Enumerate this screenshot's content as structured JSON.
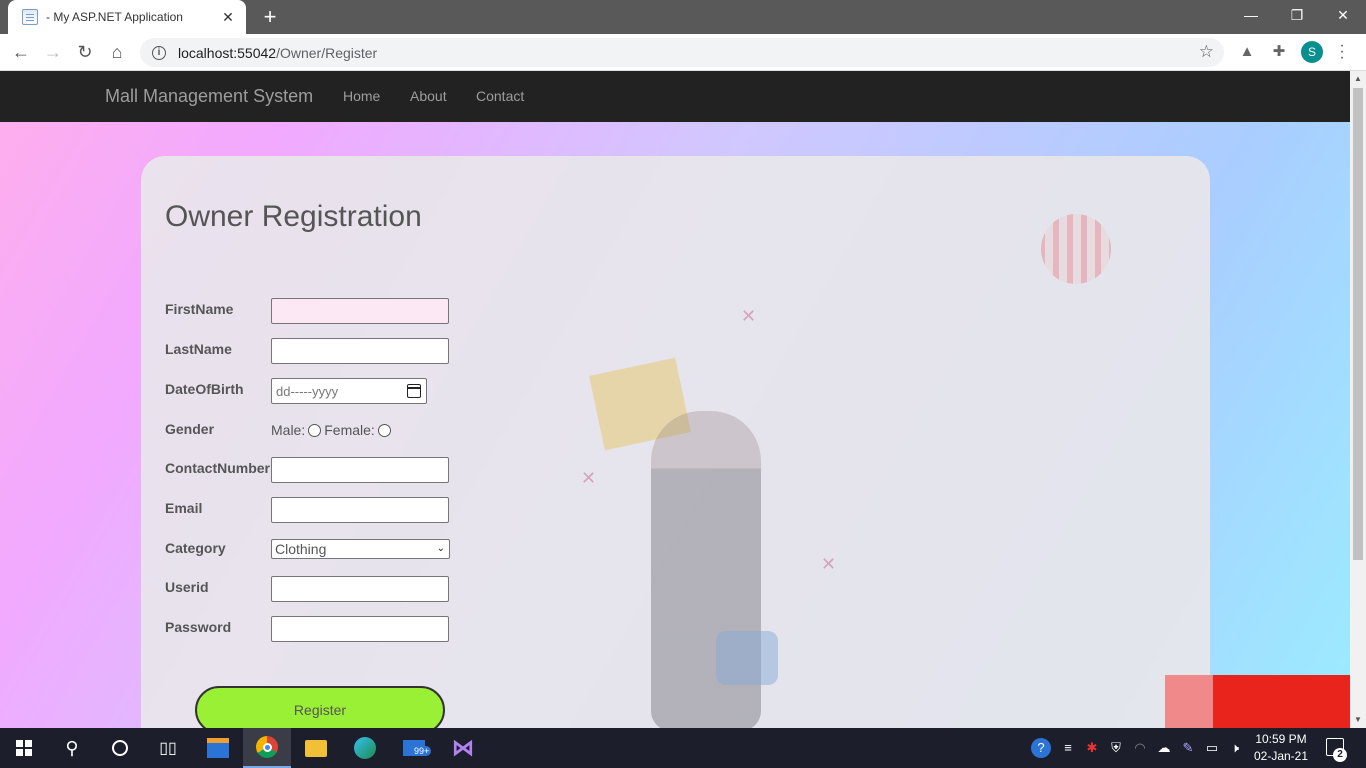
{
  "browser": {
    "tab_title": "- My ASP.NET Application",
    "url_host": "localhost:55042",
    "url_path": "/Owner/Register",
    "profile_initial": "S"
  },
  "site": {
    "brand": "Mall Management System",
    "nav": [
      "Home",
      "About",
      "Contact"
    ]
  },
  "form": {
    "title": "Owner Registration",
    "labels": {
      "first_name": "FirstName",
      "last_name": "LastName",
      "dob": "DateOfBirth",
      "gender": "Gender",
      "contact": "ContactNumber",
      "email": "Email",
      "category": "Category",
      "userid": "Userid",
      "password": "Password"
    },
    "dob_placeholder": "dd-----yyyy",
    "gender_options": {
      "male": "Male:",
      "female": "Female:"
    },
    "category_selected": "Clothing",
    "register_label": "Register"
  },
  "taskbar": {
    "time": "10:59 PM",
    "date": "02-Jan-21",
    "mail_badge": "99+",
    "notification_count": "2"
  }
}
